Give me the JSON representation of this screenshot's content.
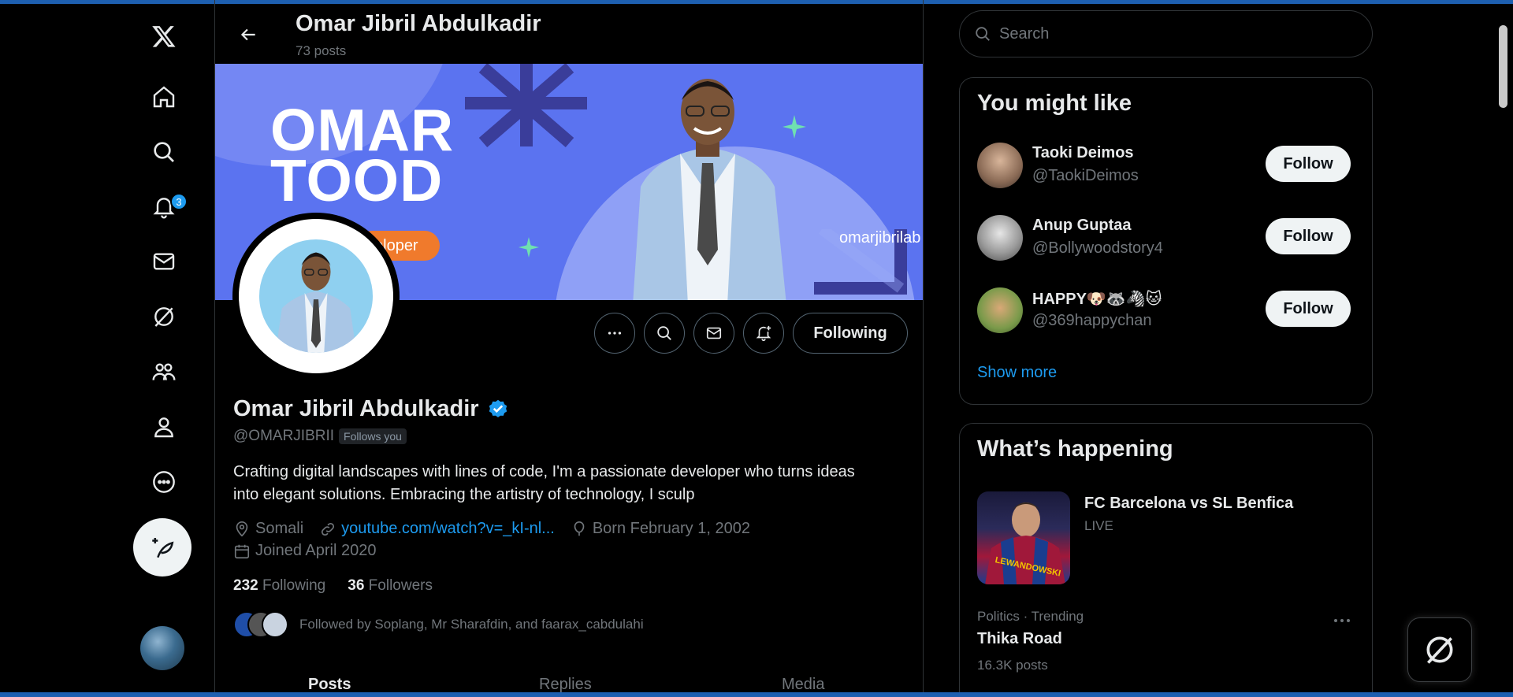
{
  "header": {
    "name": "Omar Jibril Abdulkadir",
    "posts": "73 posts"
  },
  "nav": {
    "notifications_badge": "3"
  },
  "banner": {
    "line1": "OMAR",
    "line2": "TOOD",
    "pill": "eloper",
    "handle": "omarjibrilab"
  },
  "profile": {
    "name": "Omar Jibril Abdulkadir",
    "handle": "@OMARJIBRII",
    "follows_you": "Follows you",
    "bio": "Crafting digital landscapes with lines of code, I'm a passionate developer who turns ideas into elegant solutions. Embracing the artistry of technology, I sculp",
    "location": "Somali",
    "website": "youtube.com/watch?v=_kI-nl...",
    "born": "Born February 1, 2002",
    "joined": "Joined April 2020",
    "following_count": "232",
    "following_label": "Following",
    "followers_count": "36",
    "followers_label": "Followers",
    "followed_by": "Followed by Soplang, Mr Sharafdin, and faarax_cabdulahi",
    "following_button": "Following"
  },
  "tabs": [
    "Posts",
    "Replies",
    "Media"
  ],
  "search": {
    "placeholder": "Search"
  },
  "you_might_like": {
    "title": "You might like",
    "items": [
      {
        "name": "Taoki Deimos",
        "handle": "@TaokiDeimos",
        "button": "Follow"
      },
      {
        "name": "Anup Guptaa",
        "handle": "@Bollywoodstory4",
        "button": "Follow"
      },
      {
        "name": "HAPPY🐶🦝🦓🐱",
        "handle": "@369happychan",
        "button": "Follow"
      }
    ],
    "show_more": "Show more"
  },
  "whats_happening": {
    "title": "What’s happening",
    "event_title": "FC Barcelona vs SL Benfica",
    "event_status": "LIVE",
    "trend_context": "Politics · Trending",
    "trend_name": "Thika Road",
    "trend_count": "16.3K posts"
  },
  "colors": {
    "accent": "#1d9bf0",
    "banner": "#5b73f0",
    "muted": "#71767b"
  }
}
